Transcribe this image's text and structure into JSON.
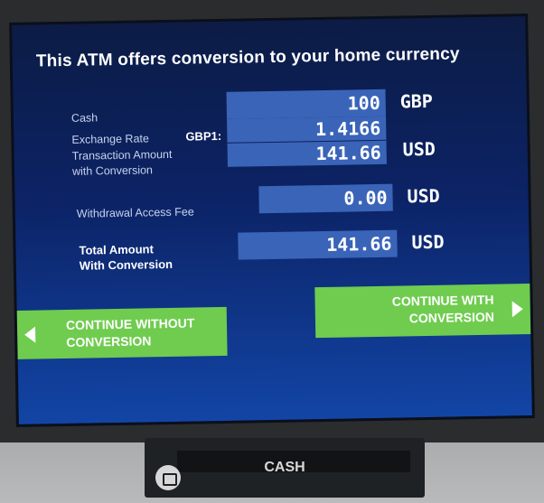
{
  "screen": {
    "title": "This ATM offers conversion to your home currency"
  },
  "rows": {
    "cash": {
      "label": "Cash",
      "value": "100",
      "unit": "GBP"
    },
    "rate": {
      "label": "Exchange Rate",
      "prefix": "GBP1:",
      "value": "1.4166"
    },
    "transaction": {
      "label_line1": "Transaction Amount",
      "label_line2": "with Conversion",
      "value": "141.66",
      "unit": "USD"
    },
    "fee": {
      "label": "Withdrawal Access Fee",
      "value": "0.00",
      "unit": "USD"
    },
    "total": {
      "label_line1": "Total Amount",
      "label_line2": "With Conversion",
      "value": "141.66",
      "unit": "USD"
    }
  },
  "buttons": {
    "without": {
      "line1": "CONTINUE WITHOUT",
      "line2": "CONVERSION"
    },
    "with": {
      "line1": "CONTINUE WITH",
      "line2": "CONVERSION"
    }
  },
  "machine": {
    "cash_label": "CASH"
  },
  "colors": {
    "accent_button": "#6fcc4f",
    "screen_top": "#0c1c45",
    "screen_bottom": "#1245a6",
    "value_box": "#3a64b8"
  }
}
